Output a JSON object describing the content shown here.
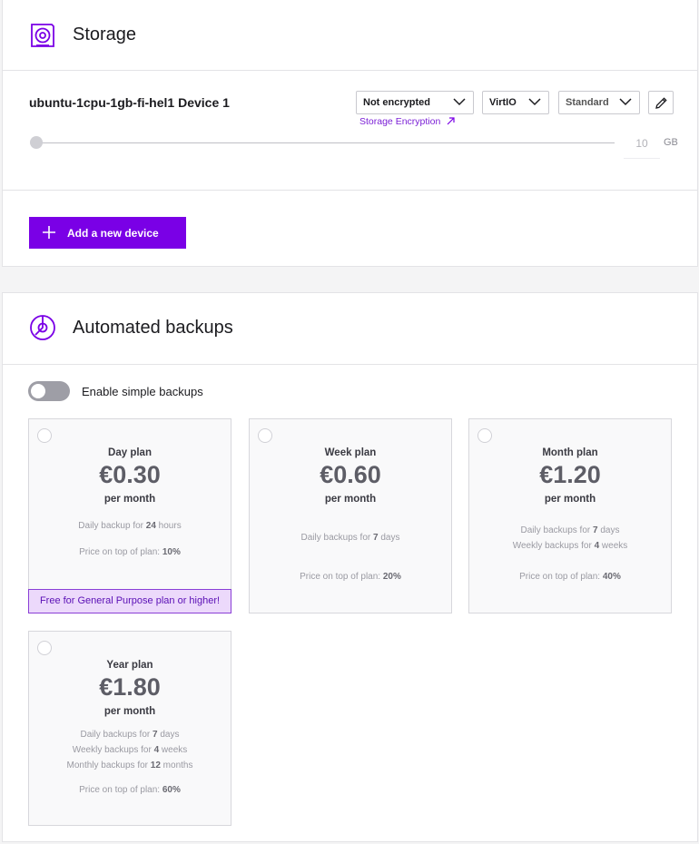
{
  "storage": {
    "title": "Storage",
    "device_name": "ubuntu-1cpu-1gb-fi-hel1 Device 1",
    "encryption_select": "Not encrypted",
    "controller_select": "VirtIO",
    "tier_select": "Standard",
    "encryption_link": "Storage Encryption",
    "size_value": "10",
    "size_unit": "GB",
    "add_device_label": "Add a new device"
  },
  "backups": {
    "title": "Automated backups",
    "toggle_label": "Enable simple backups",
    "toggle_on": false,
    "plans": [
      {
        "name": "Day plan",
        "price": "€0.30",
        "period": "per month",
        "details": [
          {
            "prefix": "Daily backup for ",
            "value": "24",
            "suffix": " hours"
          }
        ],
        "price_prefix": "Price on top of plan: ",
        "price_value": "10%",
        "badge": "Free for General Purpose plan or higher!"
      },
      {
        "name": "Week plan",
        "price": "€0.60",
        "period": "per month",
        "details": [
          {
            "prefix": "Daily backups for ",
            "value": "7",
            "suffix": " days"
          }
        ],
        "price_prefix": "Price on top of plan: ",
        "price_value": "20%"
      },
      {
        "name": "Month plan",
        "price": "€1.20",
        "period": "per month",
        "details": [
          {
            "prefix": "Daily backups for ",
            "value": "7",
            "suffix": " days"
          },
          {
            "prefix": "Weekly backups for ",
            "value": "4",
            "suffix": " weeks"
          }
        ],
        "price_prefix": "Price on top of plan: ",
        "price_value": "40%"
      },
      {
        "name": "Year plan",
        "price": "€1.80",
        "period": "per month",
        "details": [
          {
            "prefix": "Daily backups for ",
            "value": "7",
            "suffix": " days"
          },
          {
            "prefix": "Weekly backups for ",
            "value": "4",
            "suffix": " weeks"
          },
          {
            "prefix": "Monthly backups for ",
            "value": "12",
            "suffix": " months"
          }
        ],
        "price_prefix": "Price on top of plan: ",
        "price_value": "60%"
      }
    ]
  },
  "colors": {
    "accent": "#7a00e6",
    "badge_bg": "#ecd9fb",
    "badge_text": "#5a0fb5"
  },
  "icons": {
    "storage": "storage-disk-icon",
    "backups": "backup-clock-icon",
    "edit": "pencil-icon",
    "chevron": "chevron-down-icon",
    "add": "plus-icon",
    "external": "arrow-up-right-icon"
  }
}
